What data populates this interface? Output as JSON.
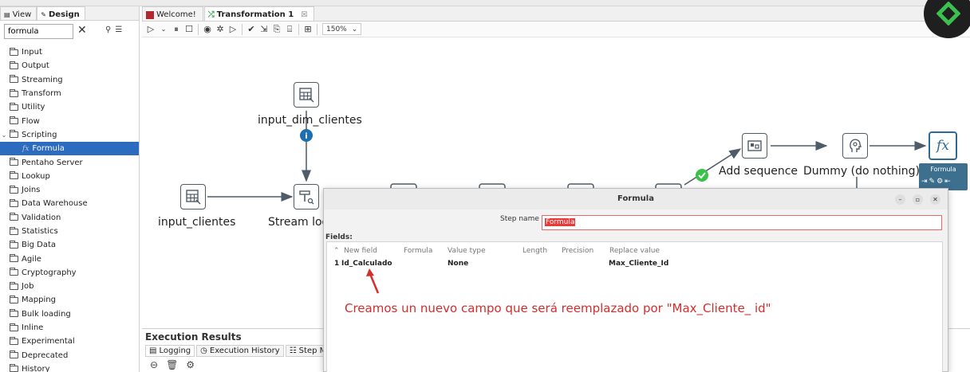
{
  "left_panel": {
    "tabs": [
      {
        "label": "View",
        "active": false
      },
      {
        "label": "Design",
        "active": true
      }
    ],
    "search": {
      "value": "formula"
    },
    "tree": [
      {
        "label": "Input",
        "type": "folder"
      },
      {
        "label": "Output",
        "type": "folder"
      },
      {
        "label": "Streaming",
        "type": "folder"
      },
      {
        "label": "Transform",
        "type": "folder"
      },
      {
        "label": "Utility",
        "type": "folder"
      },
      {
        "label": "Flow",
        "type": "folder"
      },
      {
        "label": "Scripting",
        "type": "folder",
        "expanded": true
      },
      {
        "label": "Formula",
        "type": "step",
        "selected": true
      },
      {
        "label": "Pentaho Server",
        "type": "folder"
      },
      {
        "label": "Lookup",
        "type": "folder"
      },
      {
        "label": "Joins",
        "type": "folder"
      },
      {
        "label": "Data Warehouse",
        "type": "folder"
      },
      {
        "label": "Validation",
        "type": "folder"
      },
      {
        "label": "Statistics",
        "type": "folder"
      },
      {
        "label": "Big Data",
        "type": "folder"
      },
      {
        "label": "Agile",
        "type": "folder"
      },
      {
        "label": "Cryptography",
        "type": "folder"
      },
      {
        "label": "Job",
        "type": "folder"
      },
      {
        "label": "Mapping",
        "type": "folder"
      },
      {
        "label": "Bulk loading",
        "type": "folder"
      },
      {
        "label": "Inline",
        "type": "folder"
      },
      {
        "label": "Experimental",
        "type": "folder"
      },
      {
        "label": "Deprecated",
        "type": "folder"
      },
      {
        "label": "History",
        "type": "folder"
      }
    ]
  },
  "editor_tabs": [
    {
      "label": "Welcome!",
      "active": false
    },
    {
      "label": "Transformation 1",
      "active": true
    }
  ],
  "toolbar": {
    "zoom": "150%"
  },
  "canvas": {
    "steps": {
      "input_dim_clientes": "input_dim_clientes",
      "input_clientes": "input_clientes",
      "stream_lookup": "Stream loo",
      "add_sequence": "Add sequence",
      "dummy": "Dummy (do nothing)",
      "formula_tooltip": "Formula"
    }
  },
  "execution": {
    "title": "Execution Results",
    "tabs": [
      "Logging",
      "Execution History",
      "Step Metric"
    ]
  },
  "dialog": {
    "title": "Formula",
    "step_name_label": "Step name",
    "step_name_value": "Formula",
    "fields_label": "Fields:",
    "columns": [
      "New field",
      "Formula",
      "Value type",
      "Length",
      "Precision",
      "Replace value"
    ],
    "rows": [
      {
        "num": "1",
        "new_field": "Id_Calculado",
        "formula": "",
        "value_type": "None",
        "length": "",
        "precision": "",
        "replace_value": "Max_Cliente_Id"
      }
    ]
  },
  "annotation": "Creamos un nuevo campo que será reemplazado por \"Max_Cliente_ id\"",
  "colors": {
    "selection": "#2d6bbf",
    "annotation": "#d32d2d",
    "formula_step": "#2d6b94",
    "ok_badge": "#37c24a",
    "info_badge": "#1f6fb0"
  }
}
